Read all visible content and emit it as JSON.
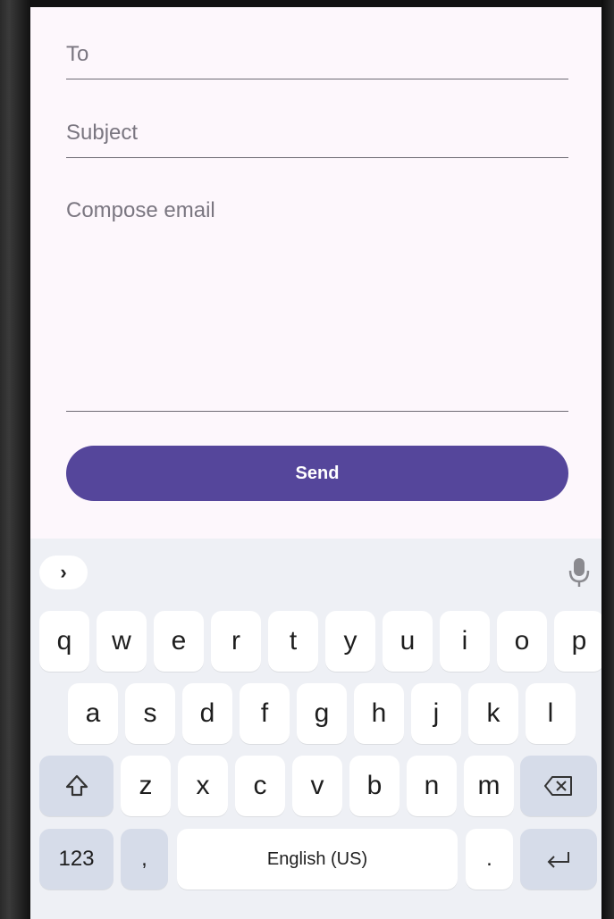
{
  "compose": {
    "to_placeholder": "To",
    "subject_placeholder": "Subject",
    "body_placeholder": "Compose email",
    "send_label": "Send"
  },
  "colors": {
    "screen_bg": "#fdf7fc",
    "accent": "#55469b",
    "keyboard_bg": "#eef0f5",
    "function_key_bg": "#d6dce9"
  },
  "keyboard": {
    "toolbar_expand_glyph": "›",
    "row1": [
      "q",
      "w",
      "e",
      "r",
      "t",
      "y",
      "u",
      "i",
      "o",
      "p"
    ],
    "row2": [
      "a",
      "s",
      "d",
      "f",
      "g",
      "h",
      "j",
      "k",
      "l"
    ],
    "row3": [
      "z",
      "x",
      "c",
      "v",
      "b",
      "n",
      "m"
    ],
    "numbers_label": "123",
    "comma_label": ",",
    "space_label": "English (US)",
    "period_label": ".",
    "icons": {
      "shift": "shift-icon",
      "backspace": "backspace-icon",
      "enter": "enter-icon",
      "mic": "microphone-icon",
      "expand": "chevron-right-icon"
    }
  }
}
